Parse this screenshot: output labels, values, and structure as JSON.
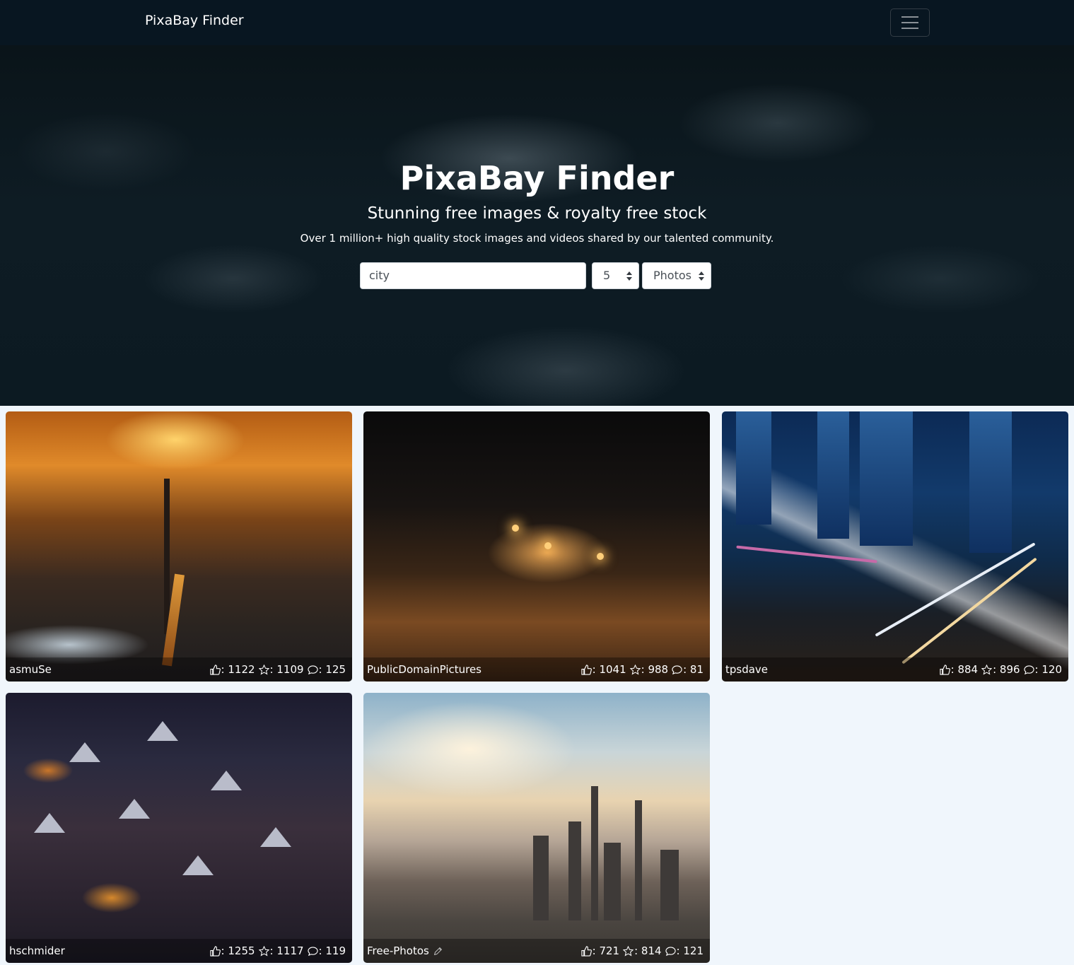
{
  "navbar": {
    "brand": "PixaBay Finder",
    "menu_icon": "hamburger-icon"
  },
  "hero": {
    "title": "PixaBay Finder",
    "subtitle": "Stunning free images & royalty free stock",
    "tagline": "Over 1 million+ high quality stock images and videos shared by our talented community.",
    "search": {
      "value": "city"
    },
    "count_select": {
      "selected": "5"
    },
    "type_select": {
      "selected": "Photos"
    }
  },
  "results": [
    {
      "author": "asmuSe",
      "likes": ": 1122",
      "favorites": ": 1109",
      "comments": ": 125"
    },
    {
      "author": "PublicDomainPictures",
      "likes": ": 1041",
      "favorites": ": 988",
      "comments": ": 81"
    },
    {
      "author": "tpsdave",
      "likes": ": 884",
      "favorites": ": 896",
      "comments": ": 120"
    },
    {
      "author": "hschmider",
      "likes": ": 1255",
      "favorites": ": 1117",
      "comments": ": 119"
    },
    {
      "author": "Free-Photos",
      "likes": ": 721",
      "favorites": ": 814",
      "comments": ": 121",
      "badge_icon": "edit-icon"
    }
  ]
}
